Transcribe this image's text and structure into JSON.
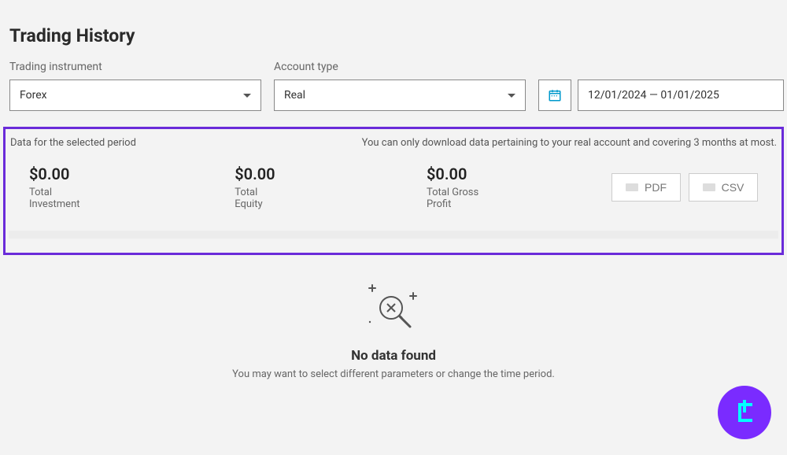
{
  "title": "Trading History",
  "filters": {
    "instrument_label": "Trading instrument",
    "instrument_value": "Forex",
    "account_label": "Account type",
    "account_value": "Real",
    "date_range": "12/01/2024 — 01/01/2025"
  },
  "panel": {
    "left_note": "Data for the selected period",
    "right_note": "You can only download data pertaining to your real account and covering 3 months at most.",
    "stats": {
      "investment_value": "$0.00",
      "investment_label": "Total Investment",
      "equity_value": "$0.00",
      "equity_label": "Total Equity",
      "profit_value": "$0.00",
      "profit_label": "Total Gross Profit"
    },
    "export_pdf": "PDF",
    "export_csv": "CSV"
  },
  "empty": {
    "title": "No data found",
    "desc": "You may want to select different parameters or change the time period."
  }
}
